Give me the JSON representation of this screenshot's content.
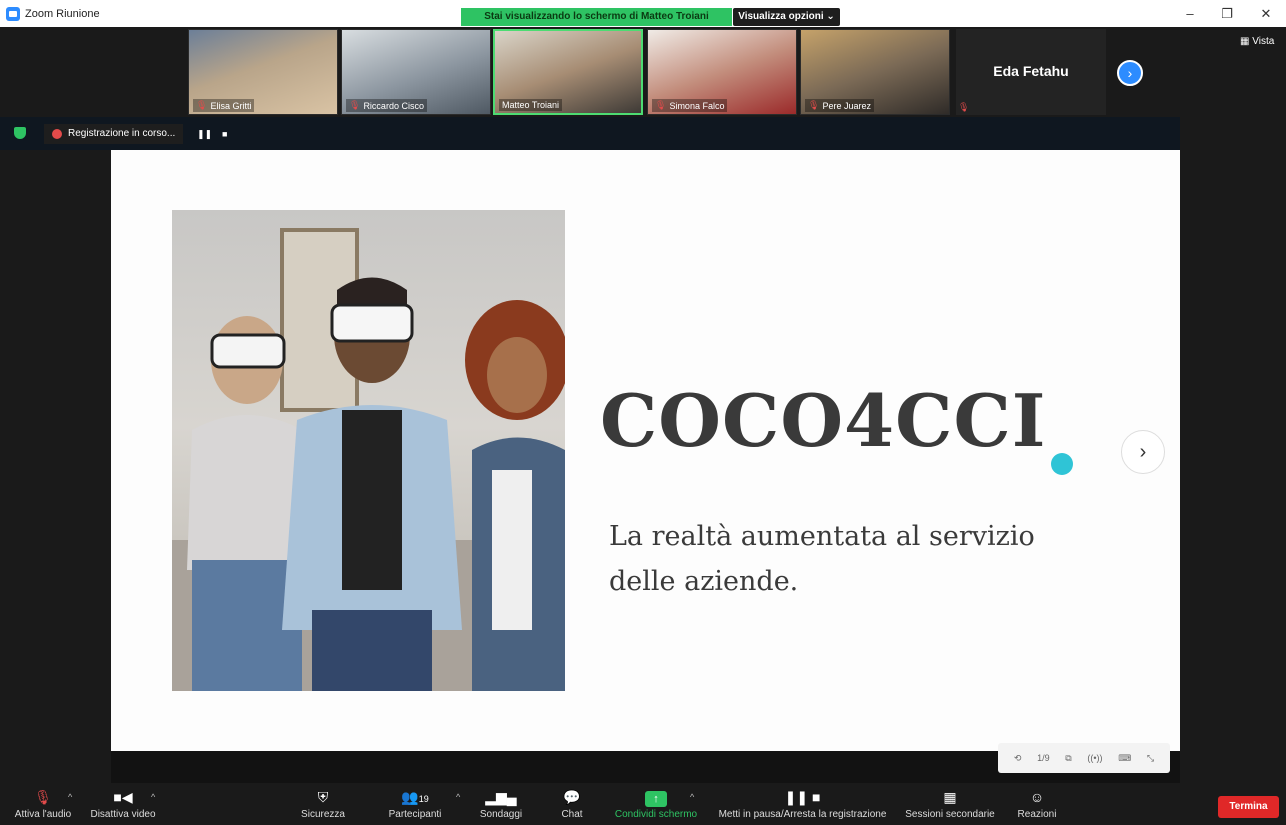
{
  "window": {
    "title": "Zoom Riunione",
    "share_banner": "Stai visualizzando lo schermo di Matteo Troiani",
    "view_options": "Visualizza opzioni ⌄",
    "vista_label": "Vista"
  },
  "participants": [
    {
      "name": "Elisa Gritti",
      "muted": true
    },
    {
      "name": "Riccardo Cisco",
      "muted": true
    },
    {
      "name": "Matteo Troiani",
      "muted": false
    },
    {
      "name": "Simona Falco",
      "muted": true
    },
    {
      "name": "Pere Juarez",
      "muted": true
    }
  ],
  "extra_tile": {
    "name": "Eda Fetahu"
  },
  "recording": {
    "label": "Registrazione in corso..."
  },
  "slide": {
    "title": "COCO4CCI",
    "subtitle_line1": "La realtà aumentata al servizio",
    "subtitle_line2": "delle aziende.",
    "page": "1/9"
  },
  "toolbar": {
    "audio": "Attiva l'audio",
    "video": "Disattiva video",
    "security": "Sicurezza",
    "participants": "Partecipanti",
    "participants_count": "19",
    "polls": "Sondaggi",
    "chat": "Chat",
    "share": "Condividi schermo",
    "pause_record": "Metti in pausa/Arresta la registrazione",
    "breakout": "Sessioni secondarie",
    "reactions": "Reazioni",
    "end": "Termina"
  },
  "colors": {
    "accent_green": "#2ec363",
    "zoom_blue": "#2d8cff",
    "end_red": "#e02828"
  }
}
